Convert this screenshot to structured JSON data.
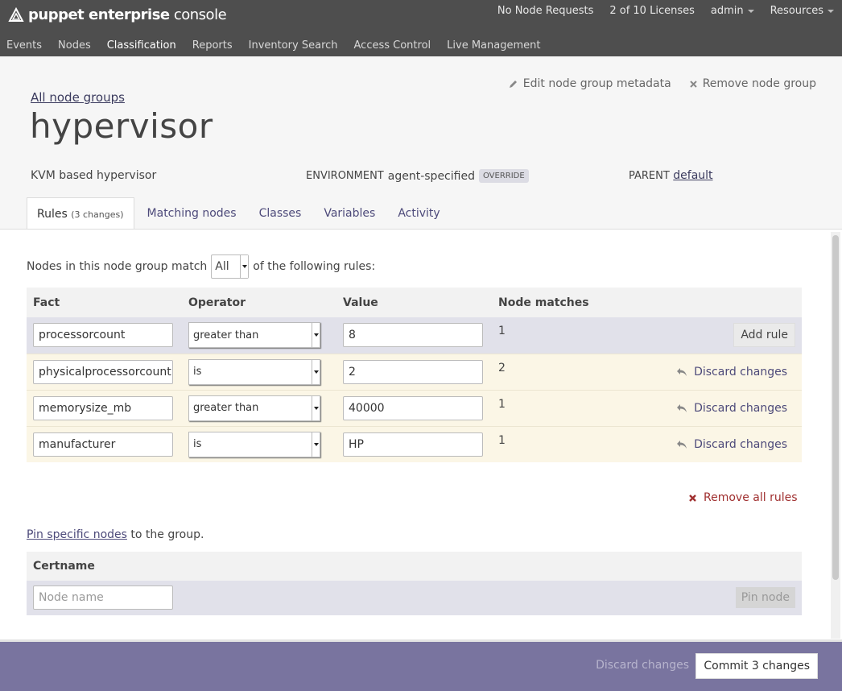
{
  "brand": {
    "name_bold": "puppet enterprise",
    "name_light": "console"
  },
  "topbar": {
    "node_requests": "No Node Requests",
    "licenses": "2 of 10 Licenses",
    "user": "admin",
    "resources": "Resources"
  },
  "nav": {
    "items": [
      "Events",
      "Nodes",
      "Classification",
      "Reports",
      "Inventory Search",
      "Access Control",
      "Live Management"
    ],
    "active": "Classification"
  },
  "header": {
    "breadcrumb": "All node groups",
    "title": "hypervisor",
    "edit_label": "Edit node group metadata",
    "remove_label": "Remove node group",
    "description": "KVM based hypervisor",
    "environment_label": "ENVIRONMENT",
    "environment_value": "agent-specified",
    "override_badge": "OVERRIDE",
    "parent_label": "PARENT",
    "parent_value": "default"
  },
  "tabs": [
    {
      "label": "Rules",
      "note": "(3 changes)"
    },
    {
      "label": "Matching nodes"
    },
    {
      "label": "Classes"
    },
    {
      "label": "Variables"
    },
    {
      "label": "Activity"
    }
  ],
  "rules": {
    "match_prefix": "Nodes in this node group match",
    "match_value": "All",
    "match_suffix": "of the following rules:",
    "columns": [
      "Fact",
      "Operator",
      "Value",
      "Node matches"
    ],
    "new_row": {
      "fact": "processorcount",
      "operator": "greater than",
      "value": "8",
      "matches": "1",
      "action": "Add rule"
    },
    "rows": [
      {
        "fact": "physicalprocessorcount",
        "operator": "is",
        "value": "2",
        "matches": "2",
        "action": "Discard changes"
      },
      {
        "fact": "memorysize_mb",
        "operator": "greater than",
        "value": "40000",
        "matches": "1",
        "action": "Discard changes"
      },
      {
        "fact": "manufacturer",
        "operator": "is",
        "value": "HP",
        "matches": "1",
        "action": "Discard changes"
      }
    ],
    "remove_all": "Remove all rules"
  },
  "pin": {
    "link": "Pin specific nodes",
    "suffix": "to the group.",
    "column": "Certname",
    "placeholder": "Node name",
    "button": "Pin node"
  },
  "footer": {
    "discard": "Discard changes",
    "commit": "Commit 3 changes"
  },
  "colors": {
    "topbar": "#4e4e4e",
    "accent": "#4d4a7a",
    "footer": "#79749f",
    "danger": "#a03030"
  }
}
